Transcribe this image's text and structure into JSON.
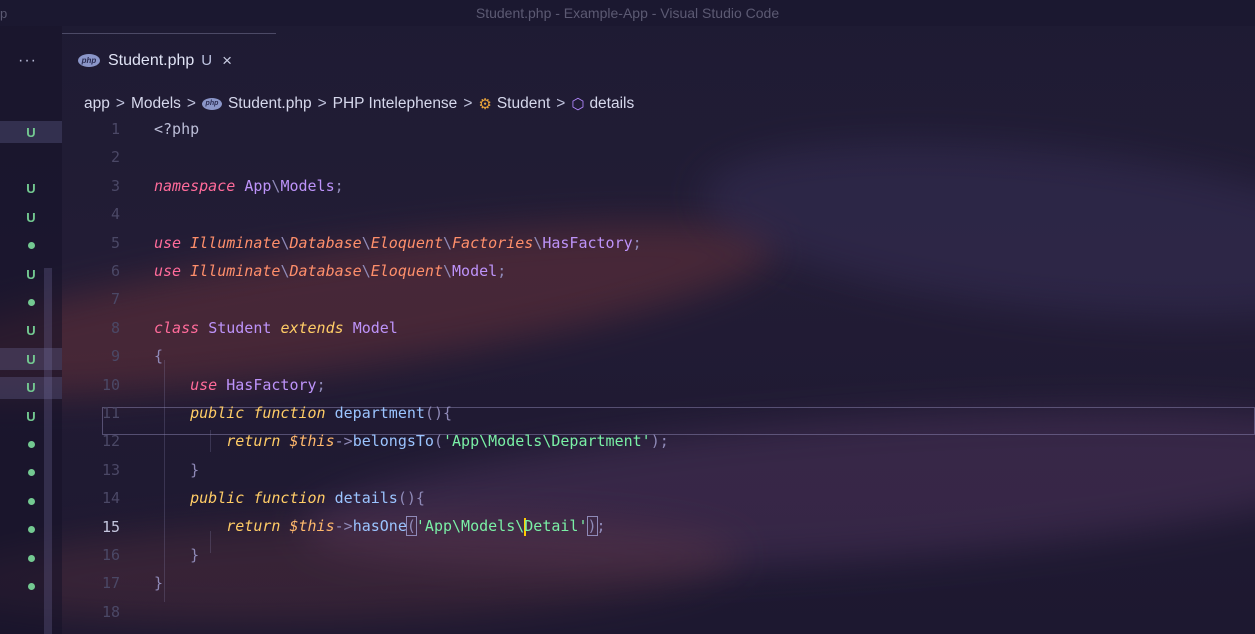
{
  "window": {
    "title": "Student.php - Example-App - Visual Studio Code",
    "corner_text": "p"
  },
  "tabs": {
    "more": "···",
    "active": {
      "icon": "php-icon",
      "filename": "Student.php",
      "badge": "U",
      "close": "×"
    }
  },
  "breadcrumb": {
    "items": [
      "app",
      "Models",
      "Student.php",
      "PHP Intelephense",
      "Student",
      "details"
    ],
    "separator": ">"
  },
  "scm_gutter": [
    {
      "line": 1,
      "mark": "U",
      "highlight": true
    },
    {
      "line": 3,
      "mark": "U"
    },
    {
      "line": 4,
      "mark": "U"
    },
    {
      "line": 5,
      "mark": "dot"
    },
    {
      "line": 6,
      "mark": "U"
    },
    {
      "line": 7,
      "mark": "dot"
    },
    {
      "line": 8,
      "mark": "U"
    },
    {
      "line": 9,
      "mark": "U",
      "highlight": true
    },
    {
      "line": 10,
      "mark": "U",
      "highlight": true
    },
    {
      "line": 11,
      "mark": "U"
    },
    {
      "line": 12,
      "mark": "dot"
    },
    {
      "line": 13,
      "mark": "dot"
    },
    {
      "line": 14,
      "mark": "dot"
    },
    {
      "line": 15,
      "mark": "dot"
    },
    {
      "line": 16,
      "mark": "dot"
    },
    {
      "line": 17,
      "mark": "dot"
    }
  ],
  "code": {
    "current_line": 15,
    "lines": [
      {
        "n": "1",
        "tokens": [
          [
            "tag",
            "<?php"
          ]
        ]
      },
      {
        "n": "2",
        "tokens": []
      },
      {
        "n": "3",
        "tokens": [
          [
            "kw",
            "namespace"
          ],
          [
            "plain",
            " "
          ],
          [
            "cls",
            "App"
          ],
          [
            "punc",
            "\\"
          ],
          [
            "cls",
            "Models"
          ],
          [
            "punc",
            ";"
          ]
        ]
      },
      {
        "n": "4",
        "tokens": []
      },
      {
        "n": "5",
        "tokens": [
          [
            "kw",
            "use"
          ],
          [
            "plain",
            " "
          ],
          [
            "nsi",
            "Illuminate"
          ],
          [
            "punc",
            "\\"
          ],
          [
            "nsi",
            "Database"
          ],
          [
            "punc",
            "\\"
          ],
          [
            "nsi",
            "Eloquent"
          ],
          [
            "punc",
            "\\"
          ],
          [
            "nsi",
            "Factories"
          ],
          [
            "punc",
            "\\"
          ],
          [
            "cls",
            "HasFactory"
          ],
          [
            "punc",
            ";"
          ]
        ]
      },
      {
        "n": "6",
        "tokens": [
          [
            "kw",
            "use"
          ],
          [
            "plain",
            " "
          ],
          [
            "nsi",
            "Illuminate"
          ],
          [
            "punc",
            "\\"
          ],
          [
            "nsi",
            "Database"
          ],
          [
            "punc",
            "\\"
          ],
          [
            "nsi",
            "Eloquent"
          ],
          [
            "punc",
            "\\"
          ],
          [
            "cls",
            "Model"
          ],
          [
            "punc",
            ";"
          ]
        ]
      },
      {
        "n": "7",
        "tokens": []
      },
      {
        "n": "8",
        "tokens": [
          [
            "kw",
            "class"
          ],
          [
            "plain",
            " "
          ],
          [
            "cls",
            "Student"
          ],
          [
            "plain",
            " "
          ],
          [
            "ext",
            "extends"
          ],
          [
            "plain",
            " "
          ],
          [
            "cls",
            "Model"
          ]
        ]
      },
      {
        "n": "9",
        "tokens": [
          [
            "punc",
            "{"
          ]
        ]
      },
      {
        "n": "10",
        "tokens": [
          [
            "plain",
            "    "
          ],
          [
            "kw",
            "use"
          ],
          [
            "plain",
            " "
          ],
          [
            "cls",
            "HasFactory"
          ],
          [
            "punc",
            ";"
          ]
        ]
      },
      {
        "n": "11",
        "tokens": [
          [
            "plain",
            "    "
          ],
          [
            "ext",
            "public"
          ],
          [
            "plain",
            " "
          ],
          [
            "ext",
            "function"
          ],
          [
            "plain",
            " "
          ],
          [
            "fn",
            "department"
          ],
          [
            "punc",
            "(){"
          ]
        ]
      },
      {
        "n": "12",
        "tokens": [
          [
            "plain",
            "        "
          ],
          [
            "ext",
            "return"
          ],
          [
            "plain",
            " "
          ],
          [
            "var",
            "$this"
          ],
          [
            "punc",
            "->"
          ],
          [
            "fn",
            "belongsTo"
          ],
          [
            "punc",
            "("
          ],
          [
            "str",
            "'App\\Models\\Department'"
          ],
          [
            "punc",
            ");"
          ]
        ]
      },
      {
        "n": "13",
        "tokens": [
          [
            "plain",
            "    "
          ],
          [
            "punc",
            "}"
          ]
        ]
      },
      {
        "n": "14",
        "tokens": [
          [
            "plain",
            "    "
          ],
          [
            "ext",
            "public"
          ],
          [
            "plain",
            " "
          ],
          [
            "ext",
            "function"
          ],
          [
            "plain",
            " "
          ],
          [
            "fn",
            "details"
          ],
          [
            "punc",
            "(){"
          ]
        ]
      },
      {
        "n": "15",
        "tokens": [
          [
            "plain",
            "        "
          ],
          [
            "ext",
            "return"
          ],
          [
            "plain",
            " "
          ],
          [
            "var",
            "$this"
          ],
          [
            "punc",
            "->"
          ],
          [
            "fn",
            "hasOne"
          ],
          [
            "bracket",
            "("
          ],
          [
            "str",
            "'App\\Models\\"
          ],
          [
            "cursor",
            ""
          ],
          [
            "str",
            "Detail'"
          ],
          [
            "bracket",
            ")"
          ],
          [
            "punc",
            ";"
          ]
        ]
      },
      {
        "n": "16",
        "tokens": [
          [
            "plain",
            "    "
          ],
          [
            "punc",
            "}"
          ]
        ]
      },
      {
        "n": "17",
        "tokens": [
          [
            "punc",
            "}"
          ]
        ]
      },
      {
        "n": "18",
        "tokens": []
      }
    ]
  },
  "colors": {
    "scm_untracked": "#73c991",
    "keyword": "#ff6b9a",
    "class": "#bd93f9",
    "string": "#7af0a6",
    "variable": "#ffb86c",
    "cursor": "#ffcc00"
  }
}
